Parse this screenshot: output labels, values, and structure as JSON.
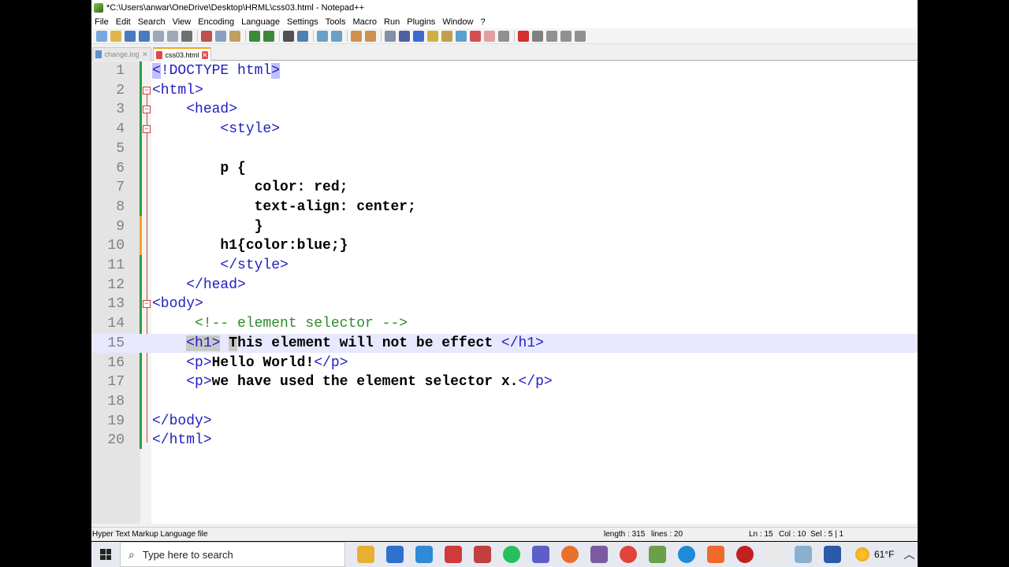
{
  "window": {
    "title": "*C:\\Users\\anwar\\OneDrive\\Desktop\\HRML\\css03.html - Notepad++"
  },
  "menu": [
    "File",
    "Edit",
    "Search",
    "View",
    "Encoding",
    "Language",
    "Settings",
    "Tools",
    "Macro",
    "Run",
    "Plugins",
    "Window",
    "?"
  ],
  "tabs": [
    {
      "label": "change.log",
      "active": false
    },
    {
      "label": "css03.html",
      "active": true
    }
  ],
  "editor": {
    "lines": [
      {
        "num": "1",
        "text": "<!DOCTYPE html>"
      },
      {
        "num": "2",
        "text": "<html>"
      },
      {
        "num": "3",
        "text": "    <head>"
      },
      {
        "num": "4",
        "text": "        <style>"
      },
      {
        "num": "5",
        "text": ""
      },
      {
        "num": "6",
        "text": "        p {"
      },
      {
        "num": "7",
        "text": "            color: red;"
      },
      {
        "num": "8",
        "text": "            text-align: center;"
      },
      {
        "num": "9",
        "text": "            }"
      },
      {
        "num": "10",
        "text": "        h1{color:blue;}"
      },
      {
        "num": "11",
        "text": "        </style>"
      },
      {
        "num": "12",
        "text": "    </head>"
      },
      {
        "num": "13",
        "text": "<body>"
      },
      {
        "num": "14",
        "text": "     <!-- element selector -->"
      },
      {
        "num": "15",
        "text": "    <h1> This element will not be effect </h1>"
      },
      {
        "num": "16",
        "text": "    <p>Hello World!</p>"
      },
      {
        "num": "17",
        "text": "    <p>we have used the element selector x.</p>"
      },
      {
        "num": "18",
        "text": ""
      },
      {
        "num": "19",
        "text": "</body>"
      },
      {
        "num": "20",
        "text": "</html>"
      }
    ]
  },
  "status": {
    "filetype": "Hyper Text Markup Language file",
    "length": "length : 315",
    "lines": "lines : 20",
    "ln": "Ln : 15",
    "col": "Col : 10",
    "sel": "Sel : 5 | 1"
  },
  "taskbar": {
    "search_placeholder": "Type here to search",
    "temperature": "61°F"
  },
  "colors": {
    "tag": "#2020c0",
    "comment": "#2e8b2e",
    "current_line": "#e8e8ff",
    "change_bar": "#2e9e3e"
  }
}
